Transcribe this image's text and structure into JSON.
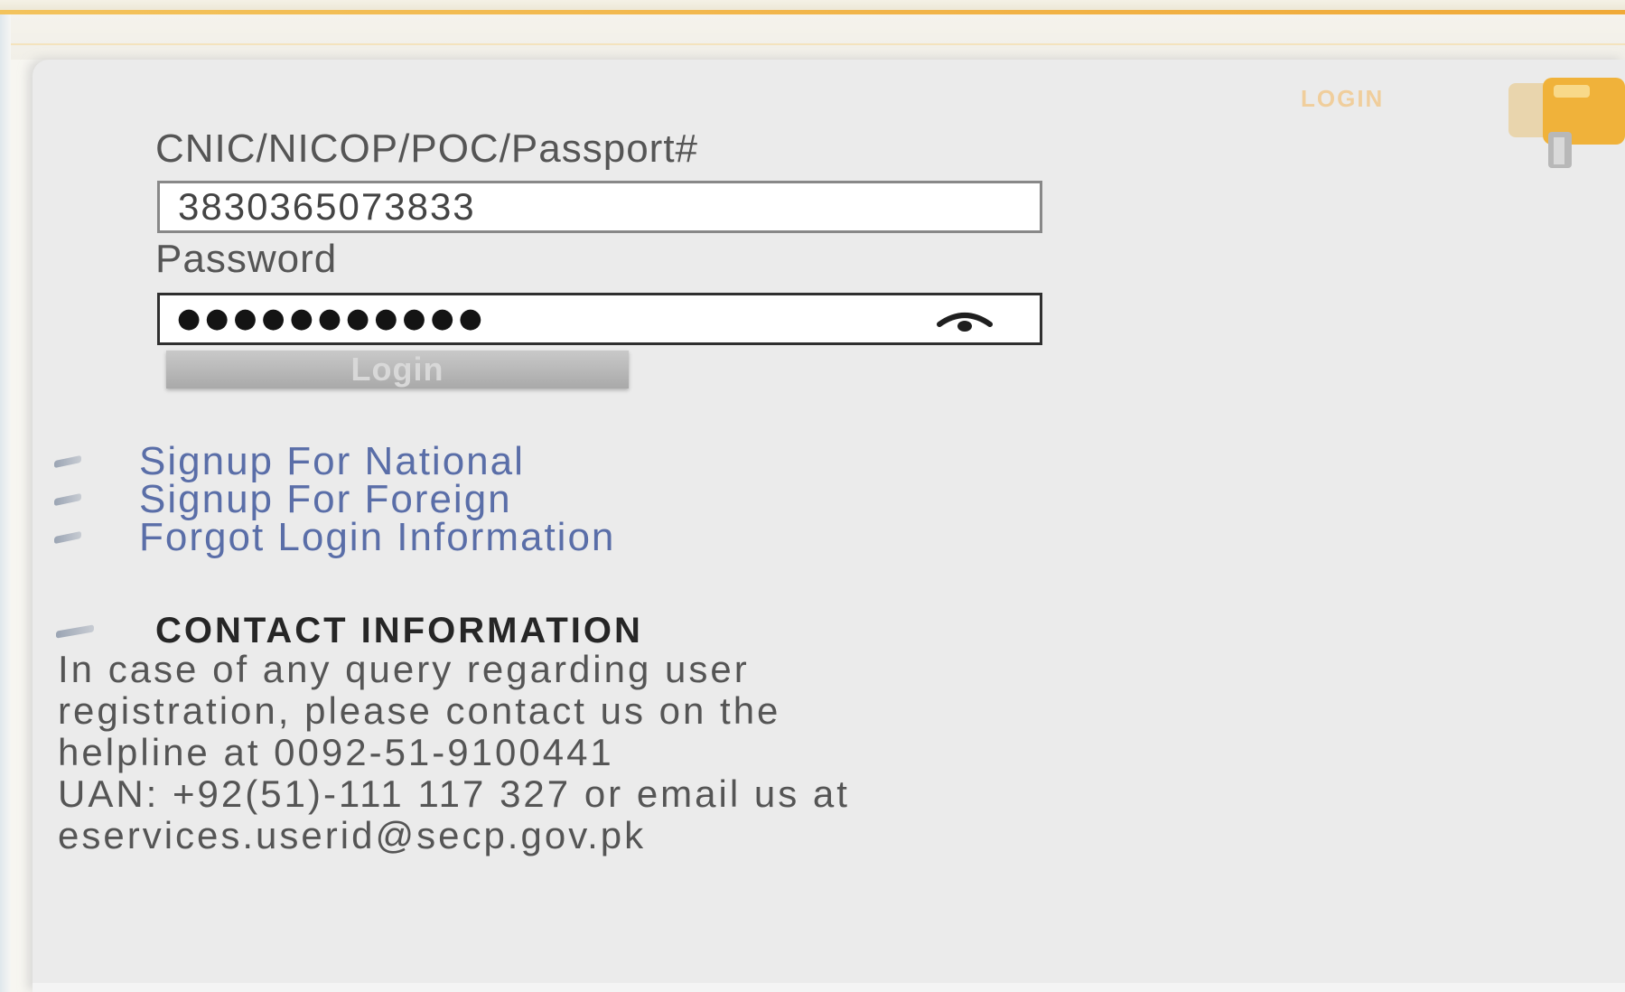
{
  "header": {
    "badge_text": "LOGIN"
  },
  "form": {
    "id_label": "CNIC/NICOP/POC/Passport#",
    "id_value": "3830365073833",
    "password_label": "Password",
    "password_masked": "●●●●●●●●●●●",
    "login_button_label": "Login"
  },
  "links": [
    {
      "label": "Signup For National"
    },
    {
      "label": "Signup For Foreign"
    },
    {
      "label": "Forgot Login Information"
    }
  ],
  "contact": {
    "heading": "CONTACT INFORMATION",
    "lines": [
      "In case of any query regarding user",
      "registration, please contact us on the",
      "helpline at 0092-51-9100441",
      "UAN: +92(51)-111 117 327 or email us at",
      "eservices.userid@secp.gov.pk"
    ]
  },
  "colors": {
    "accent_rule": "#f1b347",
    "link": "#5a6ea8",
    "panel_bg": "#ebebeb"
  },
  "icons": [
    "key-icon",
    "eye-icon",
    "bullet-icon"
  ]
}
